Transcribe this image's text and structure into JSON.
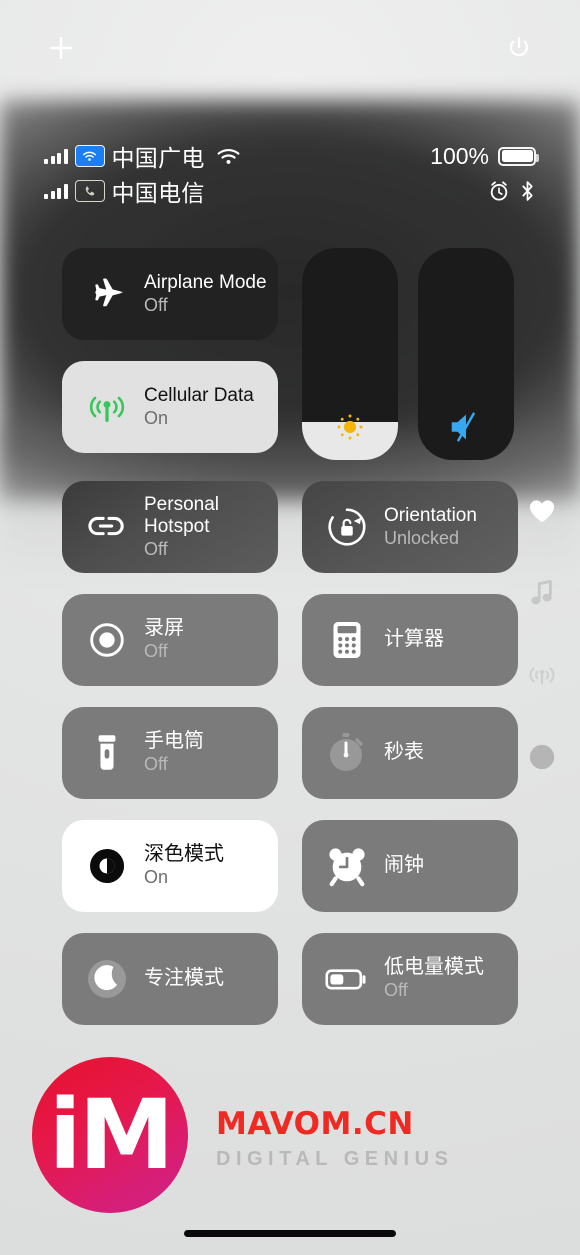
{
  "topbar": {
    "add_label": "+",
    "add_icon": "plus-icon",
    "power_icon": "power-icon"
  },
  "status_bar": {
    "line1": {
      "carrier": "中国广电",
      "sim_icon": "wifi-sim-badge-icon",
      "wifi_icon": "wifi-icon",
      "signal_bars": 4
    },
    "line2": {
      "carrier": "中国电信",
      "sim_icon": "phone-sim-badge-icon",
      "signal_bars": 4
    },
    "battery_percent": "100%",
    "battery_level": 100,
    "battery_icon": "battery-full-icon",
    "alarm_icon": "alarm-clock-icon",
    "bluetooth_icon": "bluetooth-icon"
  },
  "control_center": {
    "connectivity": {
      "airplane": {
        "name": "Airplane Mode",
        "state": "Off",
        "icon": "airplane-icon",
        "active": false
      },
      "cellular": {
        "name": "Cellular Data",
        "state": "On",
        "icon": "cellular-antenna-icon",
        "active": true,
        "accent": "#35c759"
      },
      "hotspot": {
        "name": "Personal Hotspot",
        "name_line1": "Personal",
        "name_line2": "Hotspot",
        "state": "Off",
        "icon": "hotspot-link-icon",
        "active": false
      }
    },
    "sliders": {
      "brightness": {
        "icon": "brightness-sun-icon",
        "value": 18,
        "accent": "#f5b50a"
      },
      "volume": {
        "icon": "volume-mute-icon",
        "value": 0,
        "muted": true,
        "accent": "#37a8f0"
      }
    },
    "tiles": [
      {
        "name": "Orientation",
        "state": "Unlocked",
        "icon": "rotation-lock-open-icon",
        "active": false
      },
      {
        "name": "录屏",
        "state": "Off",
        "icon": "screen-record-icon",
        "active": false
      },
      {
        "name": "计算器",
        "state": "",
        "icon": "calculator-icon",
        "active": false
      },
      {
        "name": "手电筒",
        "state": "Off",
        "icon": "flashlight-icon",
        "active": false
      },
      {
        "name": "秒表",
        "state": "",
        "icon": "stopwatch-icon",
        "active": false
      },
      {
        "name": "深色模式",
        "state": "On",
        "icon": "dark-mode-icon",
        "active": true
      },
      {
        "name": "闹钟",
        "state": "",
        "icon": "alarm-clock-icon",
        "active": false
      },
      {
        "name": "专注模式",
        "state": "",
        "icon": "focus-moon-icon",
        "active": false
      },
      {
        "name": "低电量模式",
        "state": "Off",
        "icon": "low-power-battery-icon",
        "active": false
      }
    ]
  },
  "side_rail": [
    {
      "icon": "heart-icon",
      "color": "#ffffff"
    },
    {
      "icon": "music-note-icon",
      "color": "#c7c7c7"
    },
    {
      "icon": "airplay-broadcast-icon",
      "color": "#cfcfcf"
    },
    {
      "icon": "circle-dot-icon",
      "color": "#b5b5b5"
    }
  ],
  "watermark": {
    "logo_text": "iM",
    "title": "MAVOM.CN",
    "subtitle": "DIGITAL GENIUS",
    "title_color": "#ef2a23",
    "logo_gradient_from": "#e8112d",
    "logo_gradient_to": "#cc2287"
  },
  "home_indicator": {
    "icon": "home-indicator-bar"
  }
}
